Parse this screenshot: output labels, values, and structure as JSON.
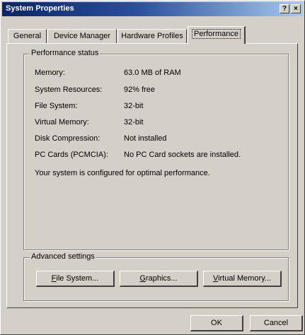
{
  "window": {
    "title": "System Properties",
    "help_button": "?",
    "close_button": "×"
  },
  "tabs": [
    {
      "label": "General",
      "active": false
    },
    {
      "label": "Device Manager",
      "active": false
    },
    {
      "label": "Hardware Profiles",
      "active": false
    },
    {
      "label": "Performance",
      "active": true
    }
  ],
  "performance_status": {
    "group_label": "Performance status",
    "rows": [
      {
        "label": "Memory:",
        "value": "63.0 MB of RAM"
      },
      {
        "label": "System Resources:",
        "value": "92% free"
      },
      {
        "label": "File System:",
        "value": "32-bit"
      },
      {
        "label": "Virtual Memory:",
        "value": "32-bit"
      },
      {
        "label": "Disk Compression:",
        "value": "Not installed"
      },
      {
        "label": "PC Cards (PCMCIA):",
        "value": "No PC Card sockets are installed."
      }
    ],
    "message": "Your system is configured for optimal performance."
  },
  "advanced_settings": {
    "group_label": "Advanced settings",
    "buttons": [
      {
        "accel": "F",
        "rest": "ile System..."
      },
      {
        "accel": "G",
        "rest": "raphics..."
      },
      {
        "accel": "V",
        "rest": "irtual Memory..."
      }
    ]
  },
  "footer": {
    "ok_label": "OK",
    "cancel_label": "Cancel"
  }
}
